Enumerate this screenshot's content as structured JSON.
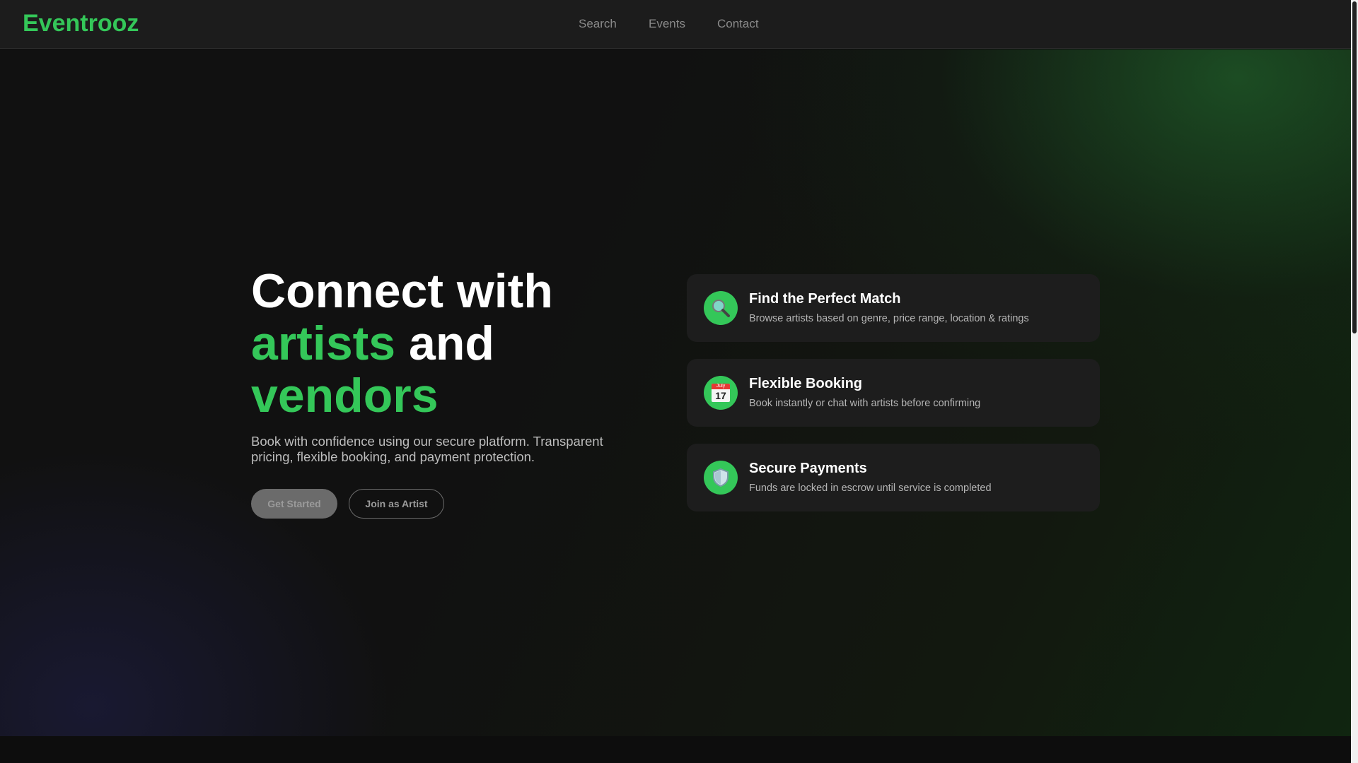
{
  "header": {
    "logo": "Eventrooz",
    "nav": [
      "Search",
      "Events",
      "Contact"
    ]
  },
  "hero": {
    "title_line1": "Connect with",
    "title_highlight1": "artists",
    "title_and": "and",
    "title_highlight2": "vendors",
    "description": "Book with confidence using our secure platform. Transparent pricing, flexible booking, and payment protection.",
    "primary_button": "Get Started",
    "secondary_button": "Join as Artist"
  },
  "features": [
    {
      "icon": "magnifier-icon",
      "title": "Find the Perfect Match",
      "description": "Browse artists based on genre, price range, location & ratings"
    },
    {
      "icon": "calendar-icon",
      "title": "Flexible Booking",
      "description": "Book instantly or chat with artists before confirming",
      "calendar_month": "July",
      "calendar_day": "17"
    },
    {
      "icon": "shield-icon",
      "title": "Secure Payments",
      "description": "Funds are locked in escrow until service is completed"
    }
  ],
  "colors": {
    "accent": "#34c759",
    "background": "#111111",
    "card": "#1d1d1d"
  }
}
